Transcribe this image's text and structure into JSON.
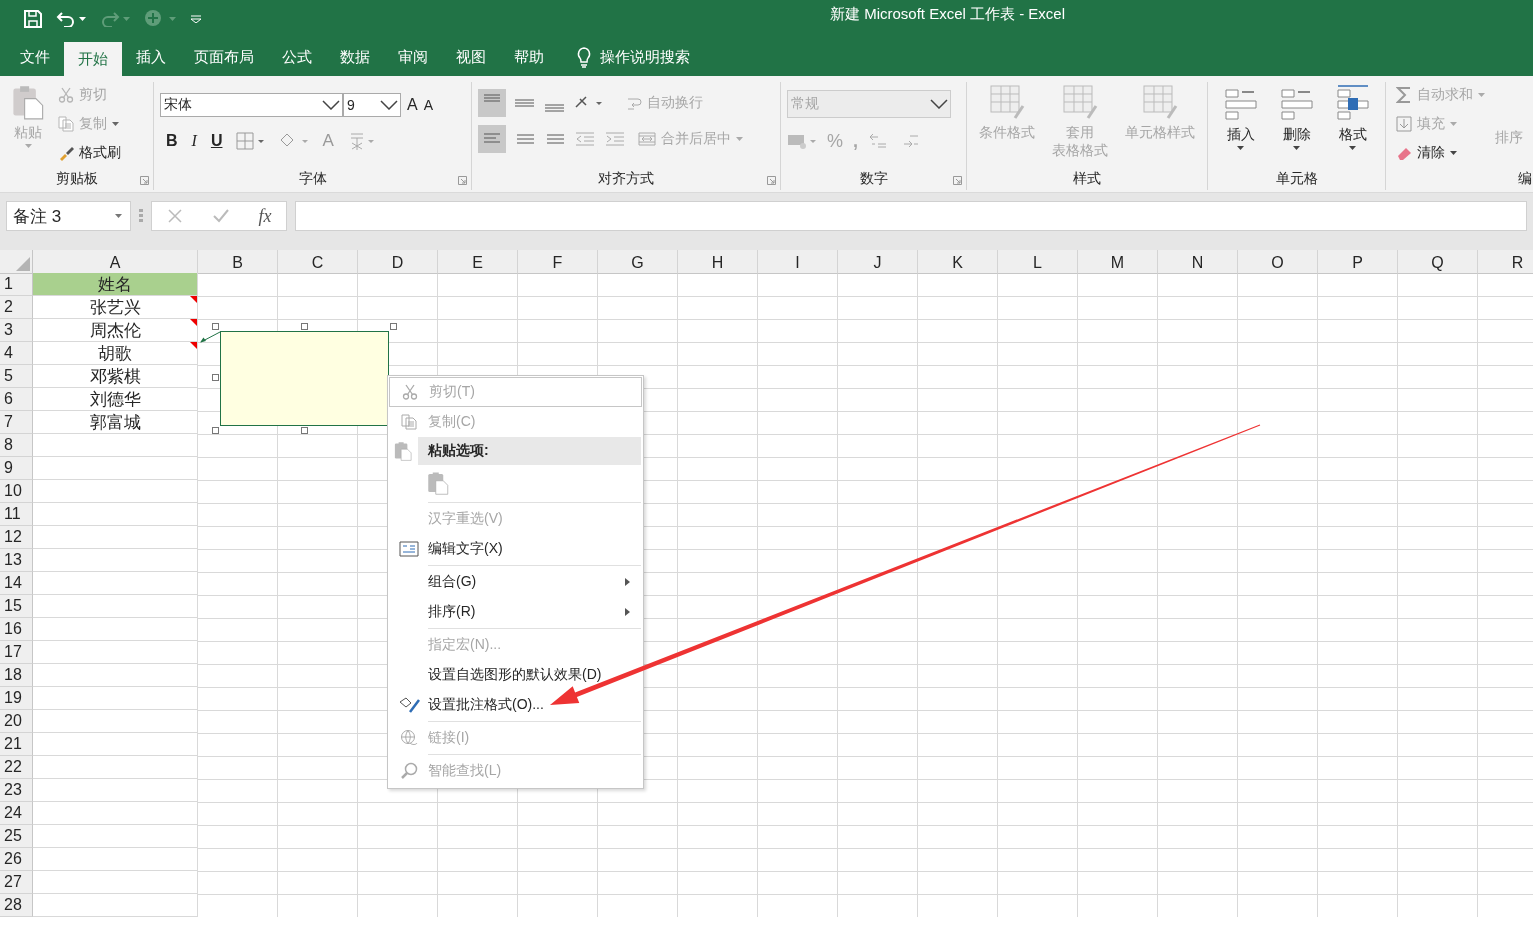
{
  "title_bar": {
    "title": "新建 Microsoft Excel 工作表  -  Excel"
  },
  "tabs": [
    {
      "label": "文件",
      "selected": false
    },
    {
      "label": "开始",
      "selected": true
    },
    {
      "label": "插入",
      "selected": false
    },
    {
      "label": "页面布局",
      "selected": false
    },
    {
      "label": "公式",
      "selected": false
    },
    {
      "label": "数据",
      "selected": false
    },
    {
      "label": "审阅",
      "selected": false
    },
    {
      "label": "视图",
      "selected": false
    },
    {
      "label": "帮助",
      "selected": false
    }
  ],
  "tell_me": {
    "placeholder": "操作说明搜索"
  },
  "ribbon": {
    "clipboard": {
      "label": "剪贴板",
      "paste": {
        "label": "粘贴",
        "disabled": true
      },
      "cut": {
        "label": "剪切",
        "disabled": true
      },
      "copy": {
        "label": "复制",
        "disabled": true
      },
      "format_painter": {
        "label": "格式刷",
        "disabled": false
      }
    },
    "font": {
      "label": "字体",
      "font_name": "宋体",
      "font_size": "9",
      "grow": "A",
      "shrink": "A",
      "bold": "B",
      "italic": "I",
      "underline": "U",
      "font_color": "A"
    },
    "alignment": {
      "label": "对齐方式",
      "wrap_text": {
        "label": "自动换行",
        "disabled": true
      },
      "merge_center": {
        "label": "合并后居中",
        "disabled": true
      }
    },
    "number": {
      "label": "数字",
      "format": {
        "value": "常规",
        "disabled": true
      },
      "percent": "%",
      "comma": ","
    },
    "styles": {
      "label": "样式",
      "buttons": [
        {
          "lines": [
            "条件格式"
          ],
          "disabled": true
        },
        {
          "lines": [
            "套用",
            "表格格式"
          ],
          "disabled": true
        },
        {
          "lines": [
            "单元格样式"
          ],
          "disabled": true
        }
      ]
    },
    "cells": {
      "label": "单元格",
      "buttons": [
        {
          "label": "插入",
          "disabled": false
        },
        {
          "label": "删除",
          "disabled": false
        },
        {
          "label": "格式",
          "disabled": false
        }
      ]
    },
    "editing": {
      "label": "编",
      "autosum": {
        "label": "自动求和",
        "disabled": true
      },
      "fill": {
        "label": "填充",
        "disabled": true
      },
      "clear": {
        "label": "清除",
        "disabled": false
      },
      "sort": {
        "label": "排序",
        "disabled": true
      }
    }
  },
  "formula_bar": {
    "name_box": "备注 3",
    "function_label": "fx"
  },
  "sheet": {
    "columns": [
      "A",
      "B",
      "C",
      "D",
      "E",
      "F",
      "G",
      "H",
      "I",
      "J",
      "K",
      "L",
      "M",
      "N",
      "O",
      "P",
      "Q",
      "R"
    ],
    "rows": [
      {
        "number": "1",
        "cell_a": "姓名",
        "highlighted": true,
        "has_comment": false
      },
      {
        "number": "2",
        "cell_a": "张艺兴",
        "highlighted": false,
        "has_comment": true
      },
      {
        "number": "3",
        "cell_a": "周杰伦",
        "highlighted": false,
        "has_comment": true
      },
      {
        "number": "4",
        "cell_a": "胡歌",
        "highlighted": false,
        "has_comment": true
      },
      {
        "number": "5",
        "cell_a": "邓紫棋",
        "highlighted": false,
        "has_comment": false
      },
      {
        "number": "6",
        "cell_a": "刘德华",
        "highlighted": false,
        "has_comment": false
      },
      {
        "number": "7",
        "cell_a": "郭富城",
        "highlighted": false,
        "has_comment": false
      },
      {
        "number": "8"
      },
      {
        "number": "9"
      },
      {
        "number": "10"
      },
      {
        "number": "11"
      },
      {
        "number": "12"
      },
      {
        "number": "13"
      },
      {
        "number": "14"
      },
      {
        "number": "15"
      },
      {
        "number": "16"
      },
      {
        "number": "17"
      },
      {
        "number": "18"
      },
      {
        "number": "19"
      },
      {
        "number": "20"
      },
      {
        "number": "21"
      },
      {
        "number": "22"
      },
      {
        "number": "23"
      },
      {
        "number": "24"
      },
      {
        "number": "25"
      },
      {
        "number": "26"
      },
      {
        "number": "27"
      },
      {
        "number": "28"
      }
    ]
  },
  "comment": {
    "selected": true
  },
  "context_menu": {
    "items": [
      {
        "kind": "item",
        "label": "剪切(T)",
        "disabled": true,
        "selected": true,
        "submenu": false
      },
      {
        "kind": "item",
        "label": "复制(C)",
        "disabled": true,
        "selected": false,
        "submenu": false
      },
      {
        "kind": "header",
        "label": "粘贴选项:"
      },
      {
        "kind": "paste-options"
      },
      {
        "kind": "separator"
      },
      {
        "kind": "item",
        "label": "汉字重选(V)",
        "disabled": true,
        "selected": false,
        "submenu": false
      },
      {
        "kind": "item",
        "label": "编辑文字(X)",
        "disabled": false,
        "selected": false,
        "submenu": false
      },
      {
        "kind": "separator"
      },
      {
        "kind": "item",
        "label": "组合(G)",
        "disabled": false,
        "selected": false,
        "submenu": true
      },
      {
        "kind": "item",
        "label": "排序(R)",
        "disabled": false,
        "selected": false,
        "submenu": true
      },
      {
        "kind": "separator"
      },
      {
        "kind": "item",
        "label": "指定宏(N)...",
        "disabled": true,
        "selected": false,
        "submenu": false
      },
      {
        "kind": "item",
        "label": "设置自选图形的默认效果(D)",
        "disabled": false,
        "selected": false,
        "submenu": false
      },
      {
        "kind": "item",
        "label": "设置批注格式(O)...",
        "disabled": false,
        "selected": false,
        "submenu": false
      },
      {
        "kind": "separator"
      },
      {
        "kind": "item",
        "label": "链接(I)",
        "disabled": true,
        "selected": false,
        "submenu": false
      },
      {
        "kind": "separator"
      },
      {
        "kind": "item",
        "label": "智能查找(L)",
        "disabled": true,
        "selected": false,
        "submenu": false
      }
    ]
  }
}
